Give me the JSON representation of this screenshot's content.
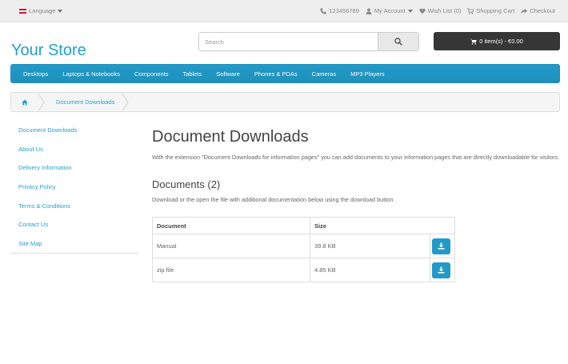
{
  "topbar": {
    "language": "Language",
    "phone": "123456789",
    "my_account": "My Account",
    "wishlist": "Wish List (0)",
    "shopping_cart": "Shopping Cart",
    "checkout": "Checkout"
  },
  "header": {
    "logo": "Your Store",
    "search_placeholder": "Search",
    "cart": "0 item(s) - €0.00"
  },
  "menu": {
    "items": [
      "Desktops",
      "Laptops & Notebooks",
      "Components",
      "Tablets",
      "Software",
      "Phones & PDAs",
      "Cameras",
      "MP3 Players"
    ]
  },
  "breadcrumb": {
    "current": "Document Downloads"
  },
  "sidebar": {
    "items": [
      "Document Downloads",
      "About Us",
      "Delivery Information",
      "Privacy Policy",
      "Terms & Conditions",
      "Contact Us",
      "Site Map"
    ]
  },
  "content": {
    "title": "Document Downloads",
    "intro": "With the extension \"Document Downloads for information pages\" you can add documents to your information pages that are directly downloadable for visitors.",
    "docs_title": "Documents (2)",
    "docs_desc": "Download or the open the file with additional documentation below using the download button.",
    "table": {
      "headers": [
        "Document",
        "Size"
      ],
      "rows": [
        {
          "document": "Manual",
          "size": "39.8 KB"
        },
        {
          "document": "zip file",
          "size": "4.85 KB"
        }
      ]
    }
  },
  "colors": {
    "accent": "#229ac8",
    "link": "#23a1d1",
    "cart_bg": "#363636"
  }
}
